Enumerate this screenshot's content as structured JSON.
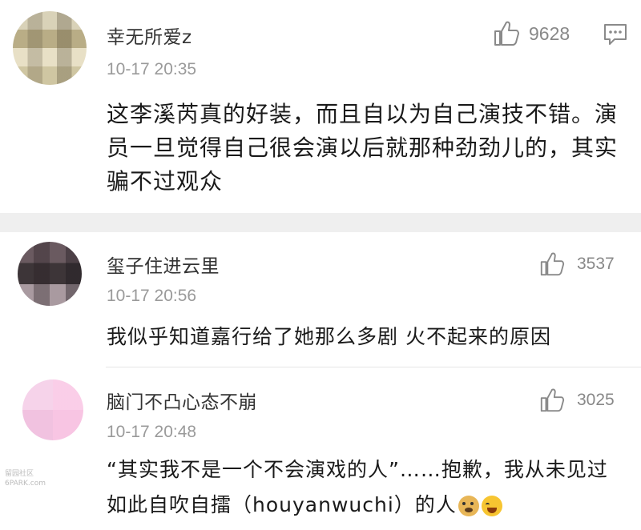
{
  "comments": [
    {
      "username": "幸无所爱z",
      "time": "10-17 20:35",
      "likes": "9628",
      "text": "这李溪芮真的好装，而且自以为自己演技不错。演员一旦觉得自己很会演以后就那种劲劲儿的，其实骗不过观众",
      "avatar_icon": "blurred-avatar-icon",
      "reply_icon": "comment-reply-icon"
    },
    {
      "username": "玺子住进云里",
      "time": "10-17 20:56",
      "likes": "3537",
      "text": "我似乎知道嘉行给了她那么多剧 火不起来的原因",
      "avatar_icon": "blurred-avatar-icon"
    },
    {
      "username": "脑门不凸心态不崩",
      "time": "10-17 20:48",
      "likes": "3025",
      "text_main": "“其实我不是一个不会演戏的人”……抱歉，我从未见过如此自吹自擂（houyanwuchi）的人",
      "emojis": [
        "doge-emoji",
        "laughing-tears-emoji"
      ],
      "avatar_icon": "blurred-avatar-icon"
    }
  ],
  "watermark": "留园社区 6PARK.com",
  "colors": {
    "separator": "#efefef",
    "muted_text": "#9a9a9a",
    "icon_gray": "#888888"
  }
}
